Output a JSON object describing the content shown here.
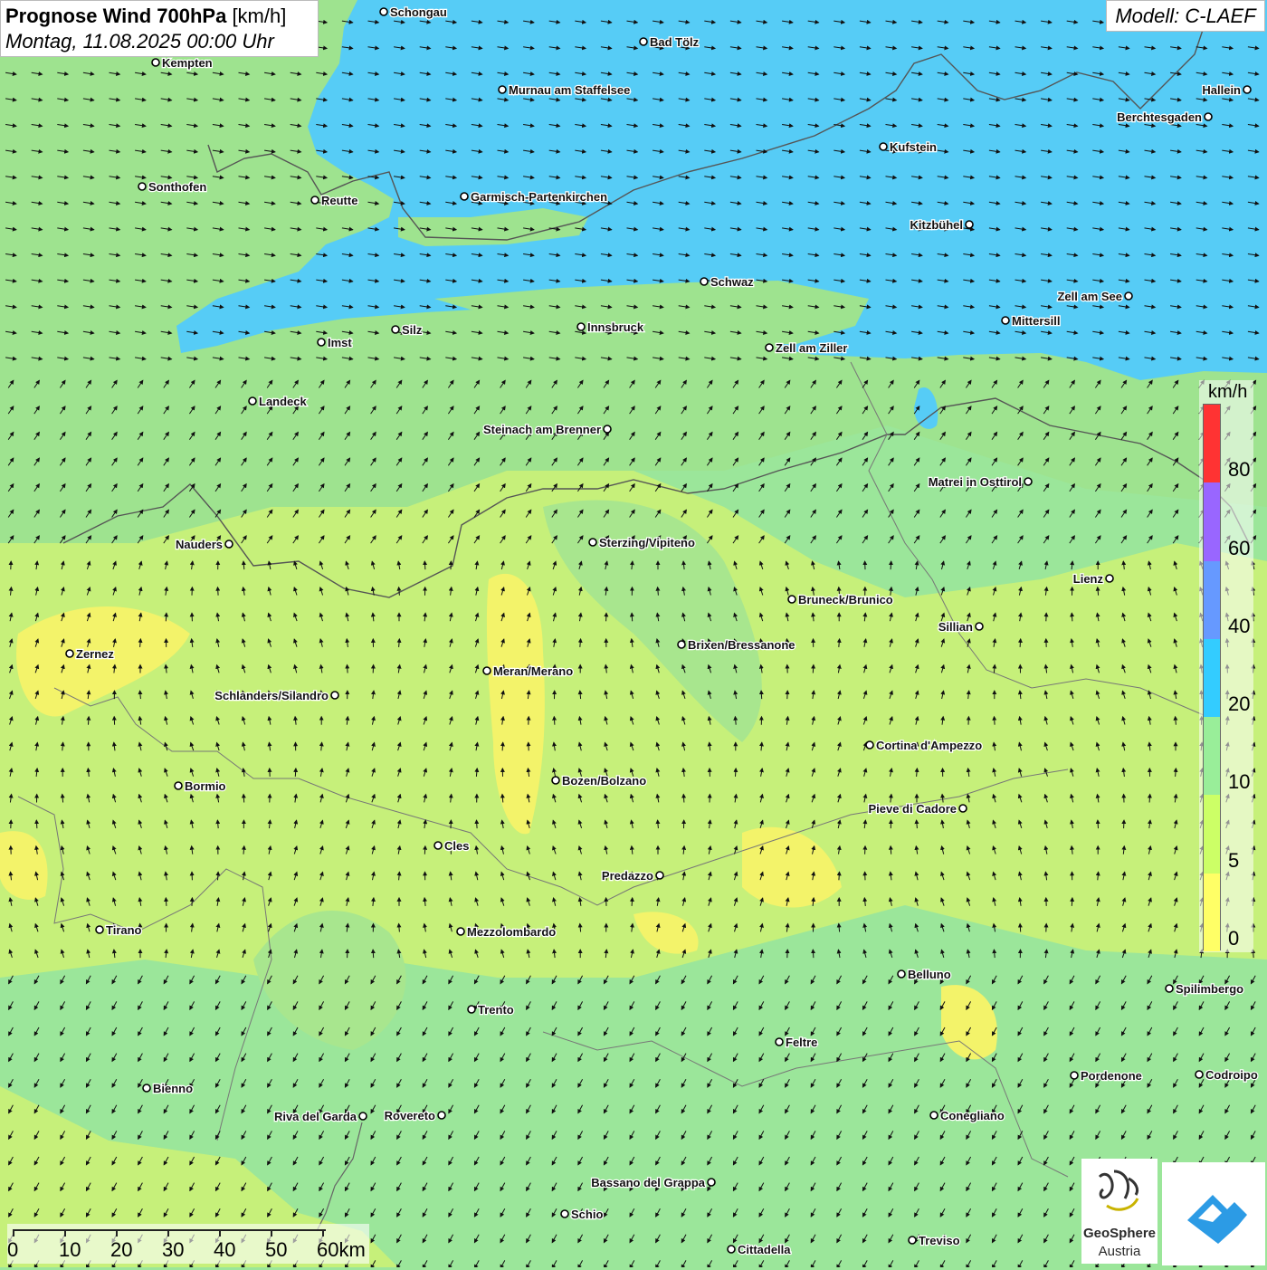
{
  "header": {
    "title_bold": "Prognose Wind 700hPa",
    "title_unit": "[km/h]",
    "subtitle": "Montag, 11.08.2025 00:00 Uhr",
    "model": "Modell: C-LAEF"
  },
  "legend": {
    "unit": "km/h",
    "classes": [
      {
        "min": 0,
        "max": 5,
        "color": "#ffff66"
      },
      {
        "min": 5,
        "max": 10,
        "color": "#ccff66"
      },
      {
        "min": 10,
        "max": 20,
        "color": "#99ee99"
      },
      {
        "min": 20,
        "max": 40,
        "color": "#33ccff"
      },
      {
        "min": 40,
        "max": 60,
        "color": "#6699ff"
      },
      {
        "min": 60,
        "max": 80,
        "color": "#9966ff"
      },
      {
        "min": 80,
        "max": 100,
        "color": "#ff3333"
      }
    ],
    "labels": [
      "0",
      "5",
      "10",
      "20",
      "40",
      "60",
      "80"
    ]
  },
  "scale_bar": {
    "labels": [
      "0",
      "10",
      "20",
      "30",
      "40",
      "50",
      "60km"
    ]
  },
  "branding": {
    "org_line1": "GeoSphere",
    "org_line2": "Austria",
    "icon": "mountain-hand-logo-icon"
  },
  "cities": [
    {
      "name": "Schongau"
    },
    {
      "name": "Bad Tölz"
    },
    {
      "name": "Kempten"
    },
    {
      "name": "Murnau am Staffelsee"
    },
    {
      "name": "Hallein"
    },
    {
      "name": "Berchtesgaden"
    },
    {
      "name": "Kufstein"
    },
    {
      "name": "Sonthofen"
    },
    {
      "name": "Reutte"
    },
    {
      "name": "Garmisch-Partenkirchen"
    },
    {
      "name": "Kitzbühel"
    },
    {
      "name": "Schwaz"
    },
    {
      "name": "Zell am See"
    },
    {
      "name": "Innsbruck"
    },
    {
      "name": "Mittersill"
    },
    {
      "name": "Silz"
    },
    {
      "name": "Imst"
    },
    {
      "name": "Zell am Ziller"
    },
    {
      "name": "Landeck"
    },
    {
      "name": "Steinach am Brenner"
    },
    {
      "name": "Matrei in Osttirol"
    },
    {
      "name": "Nauders"
    },
    {
      "name": "Sterzing/Vipiteno"
    },
    {
      "name": "Lienz"
    },
    {
      "name": "Bruneck/Brunico"
    },
    {
      "name": "Sillian"
    },
    {
      "name": "Zernez"
    },
    {
      "name": "Brixen/Bressanone"
    },
    {
      "name": "Meran/Merano"
    },
    {
      "name": "Schlanders/Silandro"
    },
    {
      "name": "Cortina d'Ampezzo"
    },
    {
      "name": "Bormio"
    },
    {
      "name": "Bozen/Bolzano"
    },
    {
      "name": "Pieve di Cadore"
    },
    {
      "name": "Cles"
    },
    {
      "name": "Predazzo"
    },
    {
      "name": "Tirano"
    },
    {
      "name": "Mezzolombardo"
    },
    {
      "name": "Belluno"
    },
    {
      "name": "Spilimbergo"
    },
    {
      "name": "Trento"
    },
    {
      "name": "Feltre"
    },
    {
      "name": "Pordenone"
    },
    {
      "name": "Codroipo"
    },
    {
      "name": "Bienno"
    },
    {
      "name": "Riva del Garda"
    },
    {
      "name": "Rovereto"
    },
    {
      "name": "Conegliano"
    },
    {
      "name": "Bassano del Grappa"
    },
    {
      "name": "Schio"
    },
    {
      "name": "Treviso"
    },
    {
      "name": "Cittadella"
    }
  ]
}
